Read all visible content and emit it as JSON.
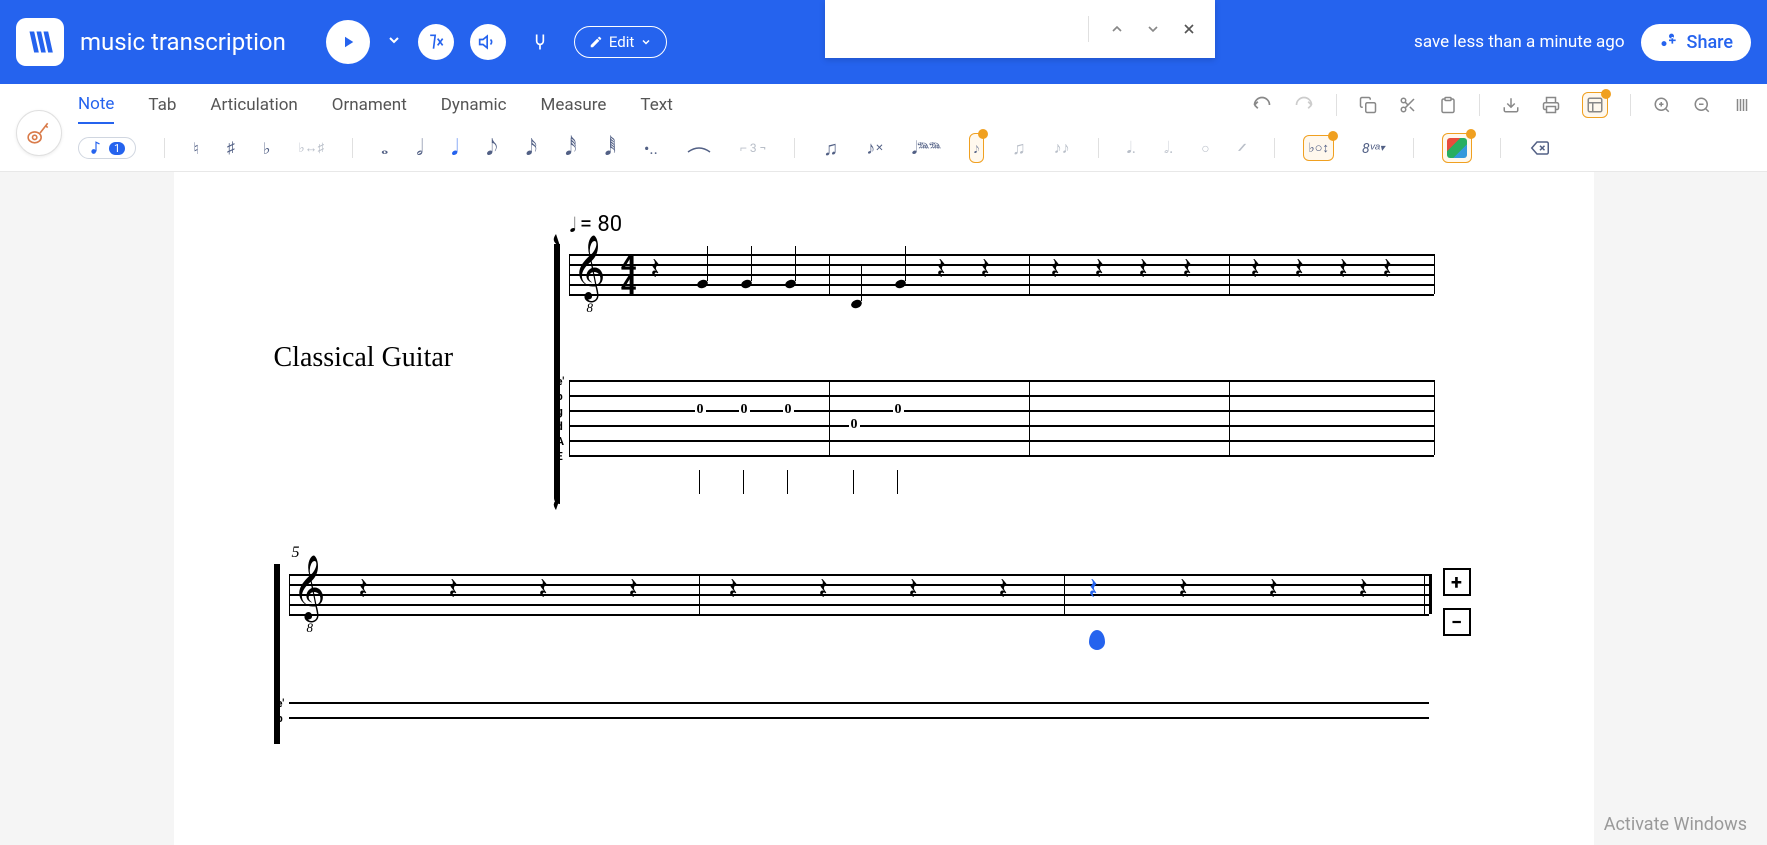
{
  "header": {
    "title": "music transcription",
    "edit_label": "Edit",
    "save_status": "save less than a minute ago",
    "share_label": "Share"
  },
  "tabs": {
    "items": [
      "Note",
      "Tab",
      "Articulation",
      "Ornament",
      "Dynamic",
      "Measure",
      "Text"
    ],
    "active_index": 0
  },
  "tools": {
    "note_pill_value": "1",
    "ottava_label": "8ᵛᵃ",
    "tuplet_label": "⌐ 3 ¬"
  },
  "score": {
    "instrument": "Classical Guitar",
    "tempo_value": "= 80",
    "time_sig_top": "4",
    "time_sig_bot": "4",
    "sub_octave": "8",
    "tab_strings": [
      "e'",
      "b",
      "g",
      "d",
      "A",
      "E"
    ],
    "tab_positions_line1": [
      "0",
      "0",
      "0",
      "0",
      "0"
    ],
    "measure_5_label": "5"
  },
  "watermark": "Activate Windows"
}
